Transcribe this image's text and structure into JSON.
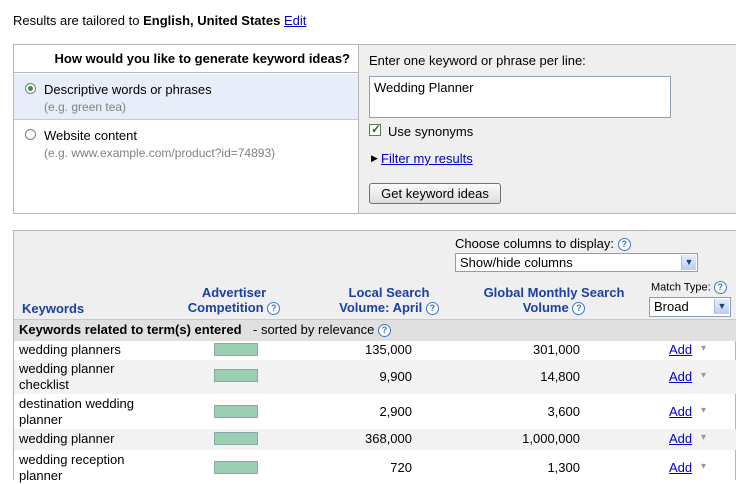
{
  "top": {
    "prefix": "Results are tailored to ",
    "locale": "English, United States",
    "edit_link": "Edit"
  },
  "ideas": {
    "question": "How would you like to generate keyword ideas?",
    "options": [
      {
        "label": "Descriptive words or phrases",
        "hint": "(e.g. green tea)",
        "selected": true
      },
      {
        "label": "Website content",
        "hint": "(e.g. www.example.com/product?id=74893)",
        "selected": false
      }
    ],
    "instruction": "Enter one keyword or phrase per line:",
    "keywords_value": "Wedding Planner",
    "use_synonyms_label": "Use synonyms",
    "use_synonyms_checked": true,
    "filter_link": "Filter my results",
    "get_button": "Get keyword ideas"
  },
  "results": {
    "choose_columns_label": "Choose columns to display:",
    "columns_select_value": "Show/hide columns",
    "match_type_label": "Match Type:",
    "match_type_value": "Broad",
    "headers": {
      "keywords": "Keywords",
      "competition_1": "Advertiser",
      "competition_2": "Competition",
      "local_1": "Local Search",
      "local_2": "Volume: April",
      "global_1": "Global Monthly Search",
      "global_2": "Volume"
    },
    "group_title": "Keywords related to term(s) entered",
    "group_sort": " - sorted by relevance",
    "rows": [
      {
        "kw1": "wedding planners",
        "kw2": "",
        "local": "135,000",
        "global": "301,000",
        "add": "Add"
      },
      {
        "kw1": "wedding planner",
        "kw2": "checklist",
        "local": "9,900",
        "global": "14,800",
        "add": "Add"
      },
      {
        "kw1": "destination wedding",
        "kw2": "planner",
        "local": "2,900",
        "global": "3,600",
        "add": "Add"
      },
      {
        "kw1": "wedding planner",
        "kw2": "",
        "local": "368,000",
        "global": "1,000,000",
        "add": "Add"
      },
      {
        "kw1": "wedding reception",
        "kw2": "planner",
        "local": "720",
        "global": "1,300",
        "add": "Add"
      }
    ]
  },
  "colors": {
    "link": "#0000cc",
    "header_blue": "#1a3fa6",
    "competition_bar": "#9ccfb2",
    "selected_option_bg": "#e8eef9"
  }
}
